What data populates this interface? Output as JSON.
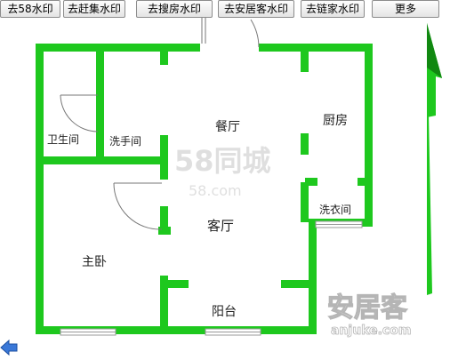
{
  "toolbar": {
    "buttons": [
      {
        "label": "去58水印"
      },
      {
        "label": "去赶集水印"
      },
      {
        "label": "去搜房水印"
      },
      {
        "label": "去安居客水印"
      },
      {
        "label": "去链家水印"
      },
      {
        "label": "更多"
      }
    ]
  },
  "floorplan": {
    "rooms": {
      "bathroom": "卫生间",
      "washroom": "洗手间",
      "dining": "餐厅",
      "kitchen": "厨房",
      "laundry": "洗衣间",
      "living": "客厅",
      "master_bedroom": "主卧",
      "balcony": "阳台"
    },
    "watermarks": {
      "brand_58": "58同城",
      "brand_58_sub": "58.com",
      "anjuke": "安居客",
      "anjuke_domain": "anjuke.com"
    }
  },
  "colors": {
    "wall": "#1ec81e",
    "wall_dark": "#10a010",
    "door": "#777777",
    "window": "#a0a0a0"
  },
  "icons": {
    "back": "back-arrow-icon",
    "north": "north-arrow-icon"
  }
}
